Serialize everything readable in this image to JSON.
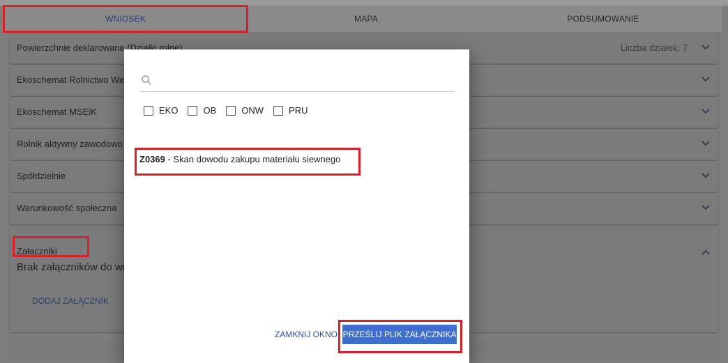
{
  "tabs": [
    {
      "label": "WNIOSEK"
    },
    {
      "label": "MAPA"
    },
    {
      "label": "PODSUMOWANIE"
    }
  ],
  "sections": [
    {
      "label": "Powierzchnie deklarowane (Działki rolne)",
      "count": "Liczba działek: 7"
    },
    {
      "label": "Ekoschemat Rolnictwo We"
    },
    {
      "label": "Ekoschemat MSEiK"
    },
    {
      "label": "Rolnik aktywny zawodowo"
    },
    {
      "label": "Spółdzielnie"
    },
    {
      "label": "Warunkowość społeczna"
    }
  ],
  "attachments": {
    "title": "Załączniki",
    "empty_text": "Brak załączników do wn",
    "add_label": "DODAJ ZAŁĄCZNIK"
  },
  "modal": {
    "search_placeholder": "",
    "filters": [
      "EKO",
      "OB",
      "ONW",
      "PRU"
    ],
    "item_code": "Z0369",
    "item_text": " - Skan dowodu zakupu materiału siewnego",
    "close_label": "ZAMKNIJ OKNO",
    "send_label": "PRZEŚLIJ PLIK ZAŁĄCZNIKA"
  },
  "colors": {
    "highlight": "#d6202a",
    "primary_button": "#3f6fce",
    "link": "#2c4da8"
  }
}
